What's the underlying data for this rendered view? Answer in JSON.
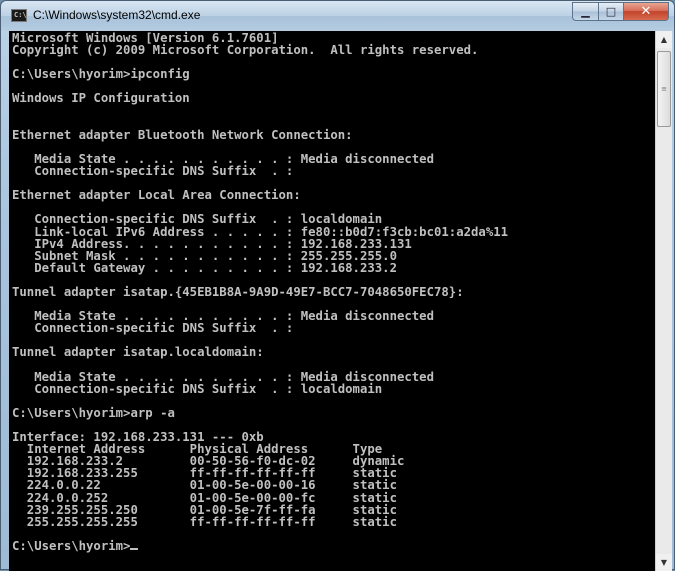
{
  "window": {
    "title": "C:\\Windows\\system32\\cmd.exe",
    "icon": "cmd-icon",
    "controls": {
      "minimize": "▁",
      "maximize": "□",
      "close": "✕"
    }
  },
  "console": {
    "text": "Microsoft Windows [Version 6.1.7601]\nCopyright (c) 2009 Microsoft Corporation.  All rights reserved.\n\nC:\\Users\\hyorim>ipconfig\n\nWindows IP Configuration\n\n\nEthernet adapter Bluetooth Network Connection:\n\n   Media State . . . . . . . . . . . : Media disconnected\n   Connection-specific DNS Suffix  . :\n\nEthernet adapter Local Area Connection:\n\n   Connection-specific DNS Suffix  . : localdomain\n   Link-local IPv6 Address . . . . . : fe80::b0d7:f3cb:bc01:a2da%11\n   IPv4 Address. . . . . . . . . . . : 192.168.233.131\n   Subnet Mask . . . . . . . . . . . : 255.255.255.0\n   Default Gateway . . . . . . . . . : 192.168.233.2\n\nTunnel adapter isatap.{45EB1B8A-9A9D-49E7-BCC7-7048650FEC78}:\n\n   Media State . . . . . . . . . . . : Media disconnected\n   Connection-specific DNS Suffix  . :\n\nTunnel adapter isatap.localdomain:\n\n   Media State . . . . . . . . . . . : Media disconnected\n   Connection-specific DNS Suffix  . : localdomain\n\nC:\\Users\\hyorim>arp -a\n\nInterface: 192.168.233.131 --- 0xb\n  Internet Address      Physical Address      Type\n  192.168.233.2         00-50-56-f0-dc-02     dynamic\n  192.168.233.255       ff-ff-ff-ff-ff-ff     static\n  224.0.0.22            01-00-5e-00-00-16     static\n  224.0.0.252           01-00-5e-00-00-fc     static\n  239.255.255.250       01-00-5e-7f-ff-fa     static\n  255.255.255.255       ff-ff-ff-ff-ff-ff     static\n\n",
    "prompt": "C:\\Users\\hyorim>"
  },
  "colors": {
    "console_bg": "#000000",
    "console_fg": "#c0c0c0",
    "close_button": "#c2432c"
  }
}
